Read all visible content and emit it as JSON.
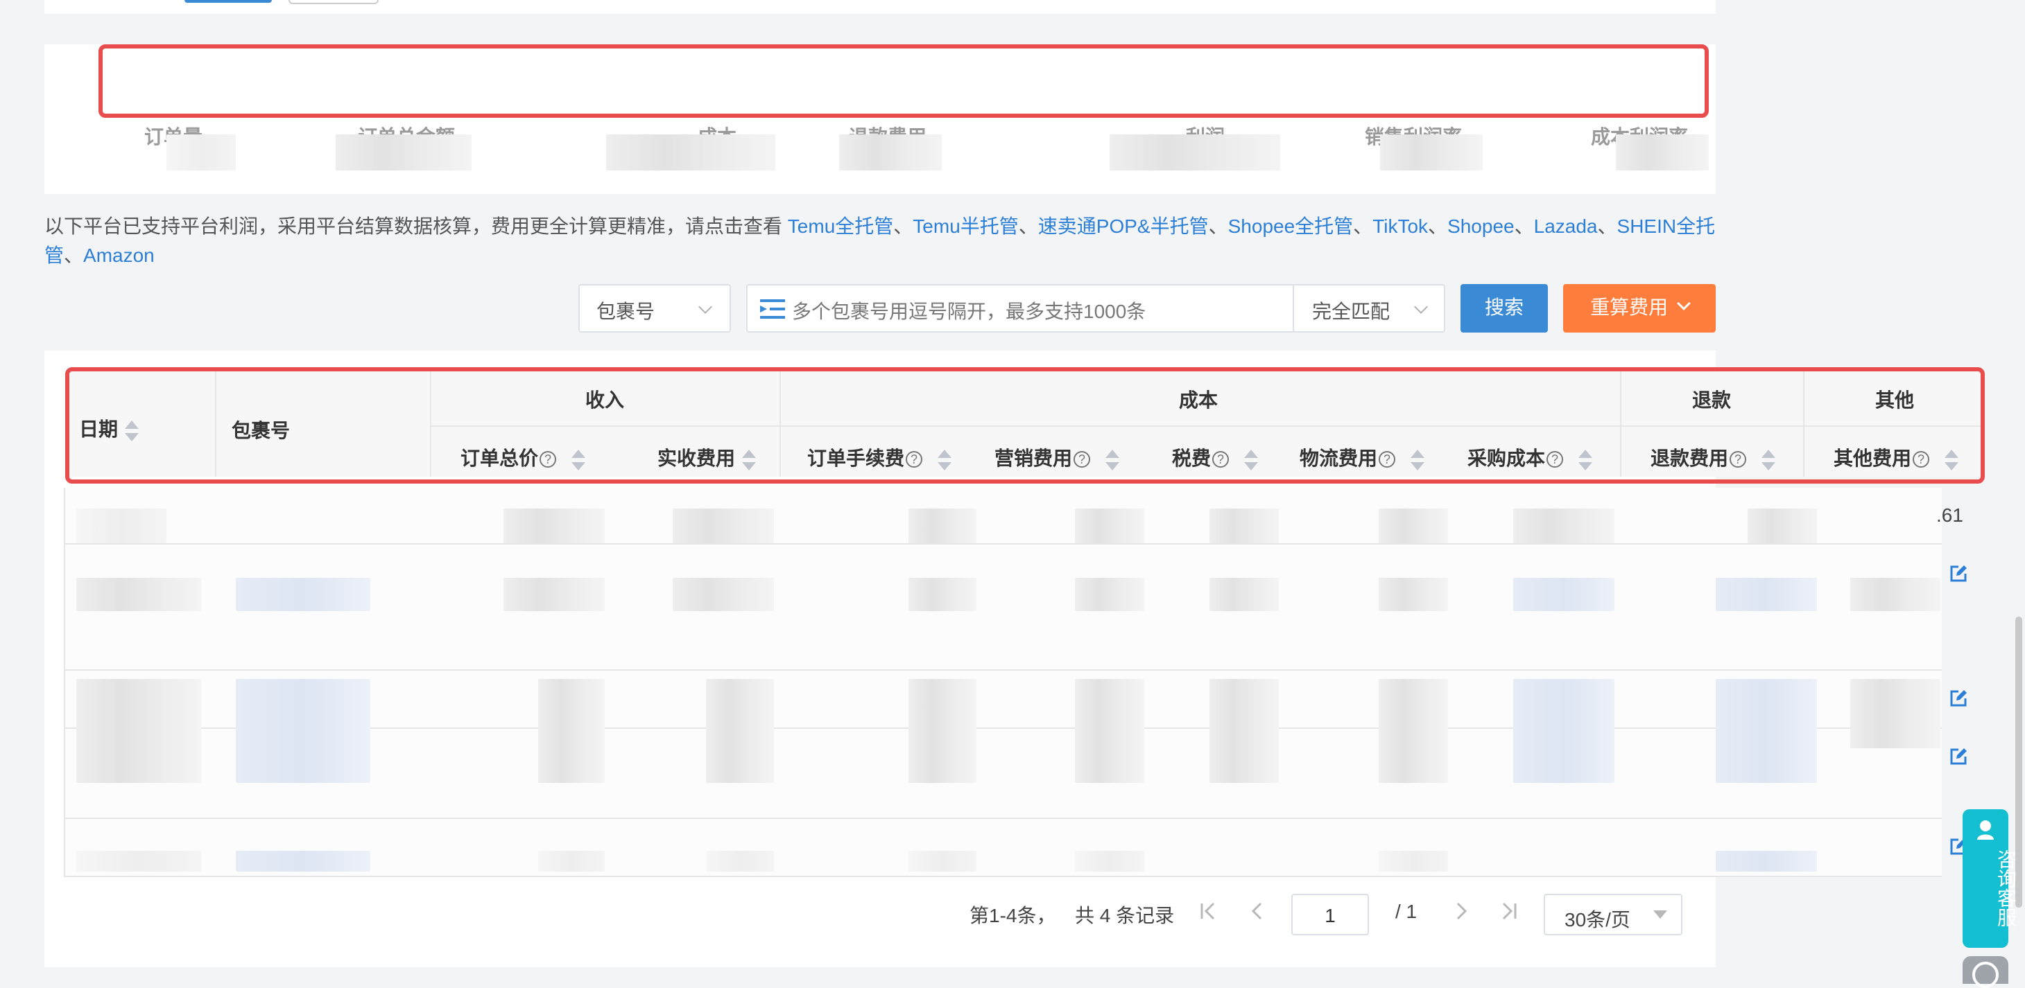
{
  "summary": {
    "labels": [
      "订单量",
      "订单总金额",
      "成本",
      "退款费用",
      "利润",
      "销售利润率",
      "成本利润率"
    ]
  },
  "notice": {
    "text": "以下平台已支持平台利润，采用平台结算数据核算，费用更全计算更精准，请点击查看 ",
    "sep": "、",
    "links": [
      "Temu全托管",
      "Temu半托管",
      "速卖通POP&半托管",
      "Shopee全托管",
      "TikTok",
      "Shopee",
      "Lazada",
      "SHEIN全托管",
      "Amazon"
    ]
  },
  "search": {
    "field_select": "包裹号",
    "input_placeholder": "多个包裹号用逗号隔开，最多支持1000条",
    "match_select": "完全匹配",
    "search_button": "搜索",
    "recalc_button": "重算费用"
  },
  "table": {
    "groups": {
      "income": "收入",
      "cost": "成本",
      "refund": "退款",
      "other": "其他"
    },
    "columns": {
      "date": "日期",
      "package_no": "包裹号",
      "order_total": "订单总价",
      "received_fee": "实收费用",
      "order_fee": "订单手续费",
      "marketing_fee": "营销费用",
      "tax": "税费",
      "logistics_fee": "物流费用",
      "purchase_cost": "采购成本",
      "refund_fee": "退款费用",
      "other_fee": "其他费用"
    },
    "help_glyph": "?",
    "partial_value": ".61"
  },
  "pagination": {
    "range": "第1-4条，",
    "total": "共 4 条记录",
    "current_page": "1",
    "total_pages": "/ 1",
    "page_size": "30条/页"
  },
  "chat": {
    "label": "咨询客服"
  },
  "colors": {
    "accent": "#2c7fd6",
    "search_button": "#3a8ad6",
    "recalc_button": "#ff7d3c",
    "highlight": "#e84c4c",
    "chat": "#13bfd1"
  }
}
